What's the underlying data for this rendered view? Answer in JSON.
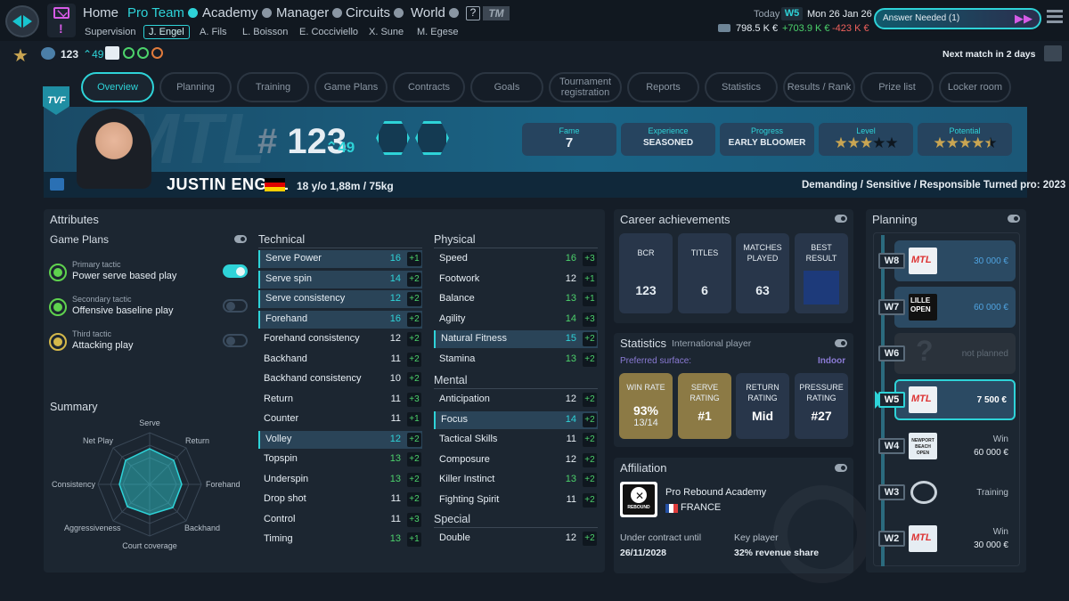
{
  "top_nav": {
    "items": [
      "Home",
      "Pro Team",
      "Academy",
      "Manager",
      "Circuits",
      "World"
    ],
    "help": "?",
    "tm": "TM"
  },
  "sub_nav": [
    "Supervision",
    "J. Engel",
    "A. Fils",
    "L. Boisson",
    "E. Cocciviello",
    "X. Sune",
    "M. Egese"
  ],
  "header_info": {
    "today_label": "Today",
    "week": "W5",
    "date": "Mon 26 Jan 26",
    "money": "798.5 K €",
    "income": "+703.9 K €",
    "expense": "-423 K €",
    "answer_needed": "Answer Needed (1)",
    "next_match": "Next match in 2 days",
    "team_rank": "123",
    "team_rank_up": "49"
  },
  "tabs": [
    "Overview",
    "Planning",
    "Training",
    "Game Plans",
    "Contracts",
    "Goals",
    "Tournament registration",
    "Reports",
    "Statistics",
    "Results / Rank",
    "Prize list",
    "Locker room"
  ],
  "player": {
    "name": "JUSTIN ENGEL",
    "rank": "123",
    "rank_up": "49",
    "age": "18 y/o",
    "size": "1,88m / 75kg",
    "traits": "Demanding / Sensitive / Responsible",
    "turned_pro": "Turned pro: 2023",
    "stats": [
      {
        "label": "Fame",
        "value": "7"
      },
      {
        "label": "Experience",
        "value": "SEASONED"
      },
      {
        "label": "Progress",
        "value": "EARLY BLOOMER"
      },
      {
        "label": "Level",
        "stars": 3,
        "max": 5
      },
      {
        "label": "Potential",
        "stars": 4.5,
        "max": 5
      }
    ]
  },
  "attributes": {
    "title": "Attributes",
    "game_plans_title": "Game Plans",
    "game_plans": [
      {
        "label": "Primary tactic",
        "value": "Power serve based play",
        "color": "#5fd24e",
        "on": true
      },
      {
        "label": "Secondary tactic",
        "value": "Offensive baseline play",
        "color": "#5fd24e",
        "on": false
      },
      {
        "label": "Third tactic",
        "value": "Attacking play",
        "color": "#d4b84a",
        "on": false
      }
    ],
    "summary_title": "Summary",
    "radar_axes": [
      "Serve",
      "Return",
      "Forehand",
      "Backhand",
      "Court coverage",
      "Aggressiveness",
      "Consistency",
      "Net Play"
    ],
    "technical_title": "Technical",
    "technical": [
      {
        "name": "Serve Power",
        "value": 16,
        "bonus": "+1",
        "hl": true
      },
      {
        "name": "Serve spin",
        "value": 14,
        "bonus": "+2",
        "hl": true
      },
      {
        "name": "Serve consistency",
        "value": 12,
        "bonus": "+2",
        "hl": true
      },
      {
        "name": "Forehand",
        "value": 16,
        "bonus": "+2",
        "hl": true
      },
      {
        "name": "Forehand consistency",
        "value": 12,
        "bonus": "+2",
        "hl": false
      },
      {
        "name": "Backhand",
        "value": 11,
        "bonus": "+2",
        "hl": false
      },
      {
        "name": "Backhand consistency",
        "value": 10,
        "bonus": "+2",
        "hl": false
      },
      {
        "name": "Return",
        "value": 11,
        "bonus": "+3",
        "hl": false
      },
      {
        "name": "Counter",
        "value": 11,
        "bonus": "+1",
        "hl": false
      },
      {
        "name": "Volley",
        "value": 12,
        "bonus": "+2",
        "hl": true
      },
      {
        "name": "Topspin",
        "value": 13,
        "bonus": "+2",
        "hl": false
      },
      {
        "name": "Underspin",
        "value": 13,
        "bonus": "+2",
        "hl": false
      },
      {
        "name": "Drop shot",
        "value": 11,
        "bonus": "+2",
        "hl": false
      },
      {
        "name": "Control",
        "value": 11,
        "bonus": "+3",
        "hl": false
      },
      {
        "name": "Timing",
        "value": 13,
        "bonus": "+1",
        "hl": false
      }
    ],
    "physical_title": "Physical",
    "physical": [
      {
        "name": "Speed",
        "value": 16,
        "bonus": "+3",
        "hl": false
      },
      {
        "name": "Footwork",
        "value": 12,
        "bonus": "+1",
        "hl": false
      },
      {
        "name": "Balance",
        "value": 13,
        "bonus": "+1",
        "hl": false
      },
      {
        "name": "Agility",
        "value": 14,
        "bonus": "+3",
        "hl": false
      },
      {
        "name": "Natural Fitness",
        "value": 15,
        "bonus": "+2",
        "hl": true
      },
      {
        "name": "Stamina",
        "value": 13,
        "bonus": "+2",
        "hl": false
      }
    ],
    "mental_title": "Mental",
    "mental": [
      {
        "name": "Anticipation",
        "value": 12,
        "bonus": "+2",
        "hl": false
      },
      {
        "name": "Focus",
        "value": 14,
        "bonus": "+2",
        "hl": true
      },
      {
        "name": "Tactical Skills",
        "value": 11,
        "bonus": "+2",
        "hl": false
      },
      {
        "name": "Composure",
        "value": 12,
        "bonus": "+2",
        "hl": false
      },
      {
        "name": "Killer Instinct",
        "value": 13,
        "bonus": "+2",
        "hl": false
      },
      {
        "name": "Fighting Spirit",
        "value": 11,
        "bonus": "+2",
        "hl": false
      }
    ],
    "special_title": "Special",
    "special": [
      {
        "name": "Double",
        "value": 12,
        "bonus": "+2",
        "hl": false
      }
    ]
  },
  "achievements": {
    "title": "Career achievements",
    "items": [
      {
        "label": "BCR",
        "value": "123"
      },
      {
        "label": "TITLES",
        "value": "6"
      },
      {
        "label": "MATCHES PLAYED",
        "value": "63"
      },
      {
        "label": "BEST RESULT",
        "value": ""
      }
    ]
  },
  "statistics": {
    "title": "Statistics",
    "subtitle": "International player",
    "surface_label": "Preferred surface:",
    "surface": "Indoor",
    "items": [
      {
        "label": "WIN RATE",
        "value": "93%",
        "sub": "13/14",
        "color": "#8c7a45"
      },
      {
        "label": "SERVE RATING",
        "value": "#1",
        "sub": "",
        "color": "#8c7a45"
      },
      {
        "label": "RETURN RATING",
        "value": "Mid",
        "sub": "",
        "color": "#28364a"
      },
      {
        "label": "PRESSURE RATING",
        "value": "#27",
        "sub": "",
        "color": "#28364a"
      }
    ]
  },
  "affiliation": {
    "title": "Affiliation",
    "club": "Pro Rebound Academy",
    "country": "FRANCE",
    "logo_text": "REBOUND",
    "contract_label": "Under contract until",
    "contract_value": "26/11/2028",
    "key_label": "Key player",
    "key_value": "32% revenue share"
  },
  "planning": {
    "title": "Planning",
    "weeks": [
      {
        "week": "W8",
        "logo": "MTL",
        "value": "30 000 €",
        "sub": "",
        "style": "blue"
      },
      {
        "week": "W7",
        "logo": "LILLE OPEN",
        "value": "60 000 €",
        "sub": "",
        "style": "blue"
      },
      {
        "week": "W6",
        "logo": "?",
        "value": "not planned",
        "sub": "",
        "style": "empty"
      },
      {
        "week": "W5",
        "logo": "MTL",
        "value": "7 500 €",
        "sub": "",
        "style": "current"
      },
      {
        "week": "W4",
        "logo": "NEWPORT BEACH OPEN",
        "value": "60 000 €",
        "sub": "Win",
        "style": "plain"
      },
      {
        "week": "W3",
        "logo": "training",
        "value": "Training",
        "sub": "",
        "style": "plain"
      },
      {
        "week": "W2",
        "logo": "MTL",
        "value": "30 000 €",
        "sub": "Win",
        "style": "plain"
      }
    ]
  },
  "colors": {
    "accent": "#2ed3d8",
    "bg": "#151d27",
    "panel": "#1c2631",
    "magenta": "#d65be6",
    "bonus_green": "#4cd26b"
  }
}
